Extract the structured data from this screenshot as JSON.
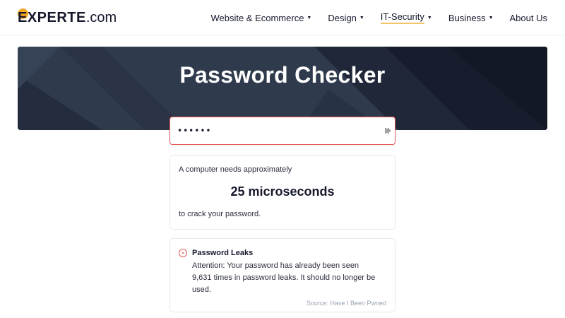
{
  "header": {
    "logo_text": "EXPERTE",
    "logo_domain": ".com",
    "nav": [
      {
        "label": "Website & Ecommerce",
        "has_dropdown": true
      },
      {
        "label": "Design",
        "has_dropdown": true
      },
      {
        "label": "IT-Security",
        "has_dropdown": true,
        "active": true
      },
      {
        "label": "Business",
        "has_dropdown": true
      },
      {
        "label": "About Us",
        "has_dropdown": false
      }
    ],
    "caret_glyph": "▼"
  },
  "hero": {
    "title": "Password Checker"
  },
  "password": {
    "value": "••••••",
    "toggle_icon": "reveal-password-icon"
  },
  "result": {
    "prefix": "A computer needs approximately",
    "time": "25 microseconds",
    "suffix": "to crack your password."
  },
  "leaks": {
    "title": "Password Leaks",
    "message": "Attention: Your password has already been seen 9,631 times in password leaks. It should no longer be used.",
    "source": "Source: Have I Been Pwned",
    "icon": "error-circle-icon"
  },
  "colors": {
    "accent": "#f5a623",
    "error": "#e05a5a",
    "hero_bg": "#2f3b4d",
    "hero_dark": "#161c2b"
  }
}
